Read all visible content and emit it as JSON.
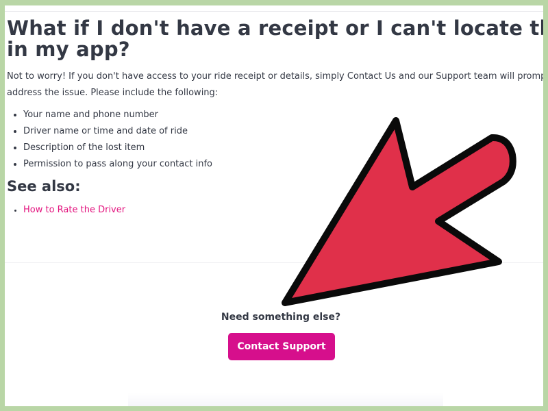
{
  "article": {
    "heading_line1": "What if I don't have a receipt or I can't locate the ride",
    "heading_line2": "in my app?",
    "intro_line1": "Not to worry! If you don't have access to your ride receipt or details, simply Contact Us and our Support team will promptly",
    "intro_line2": "address the issue. Please include the following:",
    "requirements": [
      "Your name and phone number",
      "Driver name or time and date of ride",
      "Description of the lost item",
      "Permission to pass along your contact info"
    ],
    "see_also_title": "See also:",
    "see_also_links": [
      "How to Rate the Driver"
    ]
  },
  "support": {
    "prompt": "Need something else?",
    "button_label": "Contact Support"
  },
  "overlay": {
    "icon": "red-pointer-arrow-icon",
    "color": "#e0304a"
  },
  "colors": {
    "border": "#b9d6a6",
    "text": "#333844",
    "link": "#e3137e",
    "button": "#d60f8c"
  }
}
